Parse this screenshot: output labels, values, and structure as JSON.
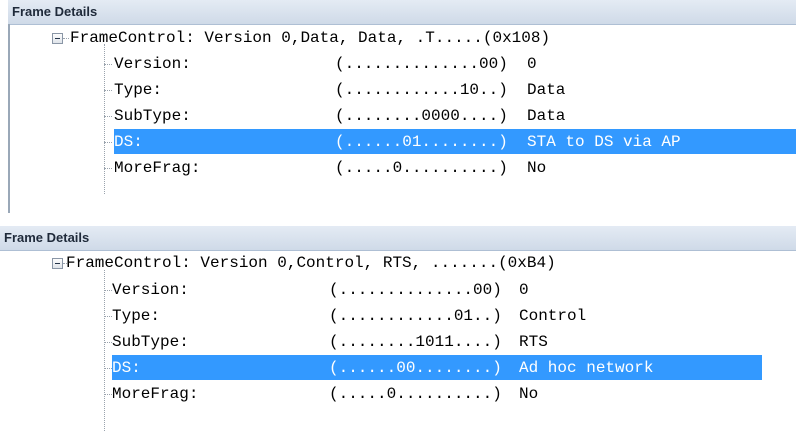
{
  "panel1": {
    "title": "Frame Details",
    "root": "FrameControl: Version 0,Data, Data, .T.....(0x108)",
    "fields": [
      {
        "name": "Version:",
        "bits": "(..............00)",
        "value": "0"
      },
      {
        "name": "Type:",
        "bits": "(............10..)",
        "value": "Data"
      },
      {
        "name": "SubType:",
        "bits": "(........0000....)",
        "value": "Data"
      },
      {
        "name": "DS:",
        "bits": "(......01........)",
        "value": "STA to DS via AP"
      },
      {
        "name": "MoreFrag:",
        "bits": "(.....0..........)",
        "value": "No"
      }
    ]
  },
  "panel2": {
    "title": "Frame Details",
    "root": "FrameControl: Version 0,Control, RTS, .......(0xB4)",
    "fields": [
      {
        "name": "Version:",
        "bits": "(..............00)",
        "value": "0"
      },
      {
        "name": "Type:",
        "bits": "(............01..)",
        "value": "Control"
      },
      {
        "name": "SubType:",
        "bits": "(........1011....)",
        "value": "RTS"
      },
      {
        "name": "DS:",
        "bits": "(......00........)",
        "value": "Ad hoc network"
      },
      {
        "name": "MoreFrag:",
        "bits": "(.....0..........)",
        "value": "No"
      }
    ]
  },
  "selection_color": "#3399ff"
}
